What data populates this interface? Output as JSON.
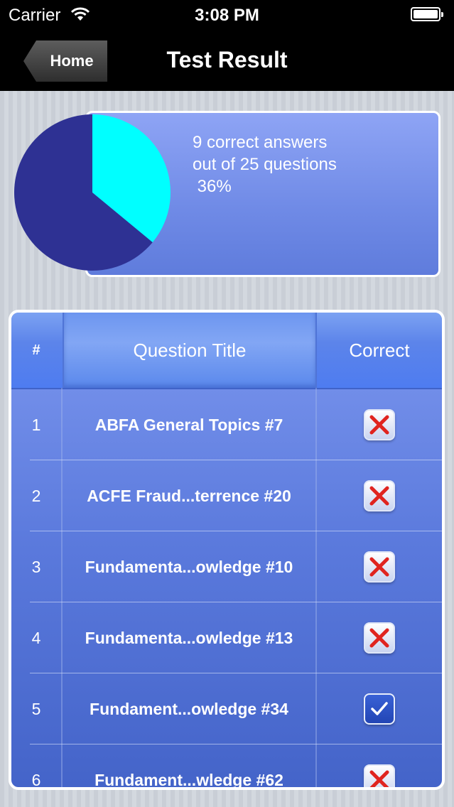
{
  "status_bar": {
    "carrier": "Carrier",
    "time": "3:08 PM"
  },
  "nav": {
    "back_label": "Home",
    "title": "Test Result"
  },
  "summary": {
    "line1": "9 correct answers",
    "line2": "out of 25 questions",
    "line3": " 36%"
  },
  "chart_data": {
    "type": "pie",
    "slices": [
      {
        "label": "correct",
        "value": 9,
        "color": "#00ffff"
      },
      {
        "label": "incorrect",
        "value": 16,
        "color": "#2e3193"
      }
    ]
  },
  "table": {
    "headers": {
      "num": "#",
      "title": "Question Title",
      "correct": "Correct"
    },
    "rows": [
      {
        "num": "1",
        "title": "ABFA General Topics #7",
        "correct": false
      },
      {
        "num": "2",
        "title": "ACFE Fraud...terrence #20",
        "correct": false
      },
      {
        "num": "3",
        "title": "Fundamenta...owledge #10",
        "correct": false
      },
      {
        "num": "4",
        "title": "Fundamenta...owledge #13",
        "correct": false
      },
      {
        "num": "5",
        "title": "Fundament...owledge #34",
        "correct": true
      },
      {
        "num": "6",
        "title": "Fundament...wledge #62",
        "correct": false
      }
    ]
  },
  "colors": {
    "wrong_mark": "#e0241f",
    "check_mark": "#ffffff"
  }
}
